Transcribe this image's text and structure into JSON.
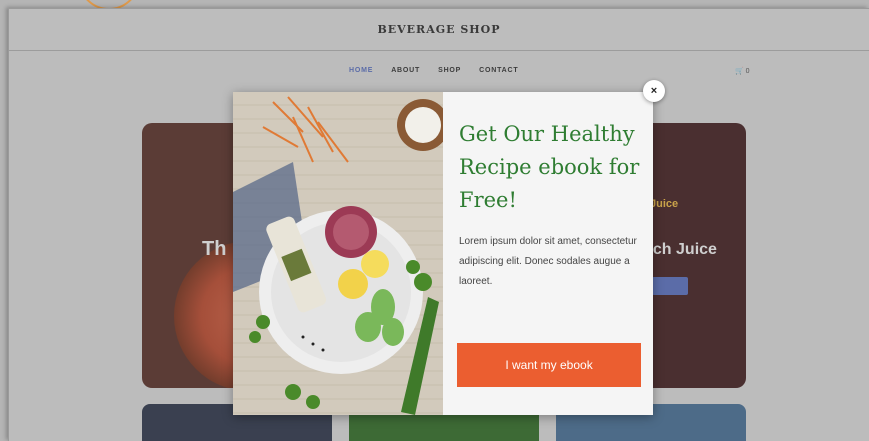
{
  "site": {
    "title": "BEVERAGE SHOP",
    "nav": [
      "HOME",
      "ABOUT",
      "SHOP",
      "CONTACT"
    ],
    "active_nav": "HOME",
    "cart_count": "0"
  },
  "background_cards": {
    "left_heading": "Th",
    "right_tag": "Juice",
    "right_heading": "ach Juice"
  },
  "popup": {
    "title": "Get Our Healthy Recipe ebook for Free!",
    "body": "Lorem ipsum dolor sit amet, consectetur adipiscing elit. Donec sodales augue a laoreet.",
    "cta_label": "I want my ebook",
    "close_symbol": "×"
  },
  "colors": {
    "title_green": "#2f7d32",
    "cta_orange": "#eb5e30",
    "nav_active": "#5b6ca8",
    "overlay_gray": "#bcbcbc"
  },
  "icons": {
    "cart": "cart-icon",
    "close": "close-icon"
  }
}
